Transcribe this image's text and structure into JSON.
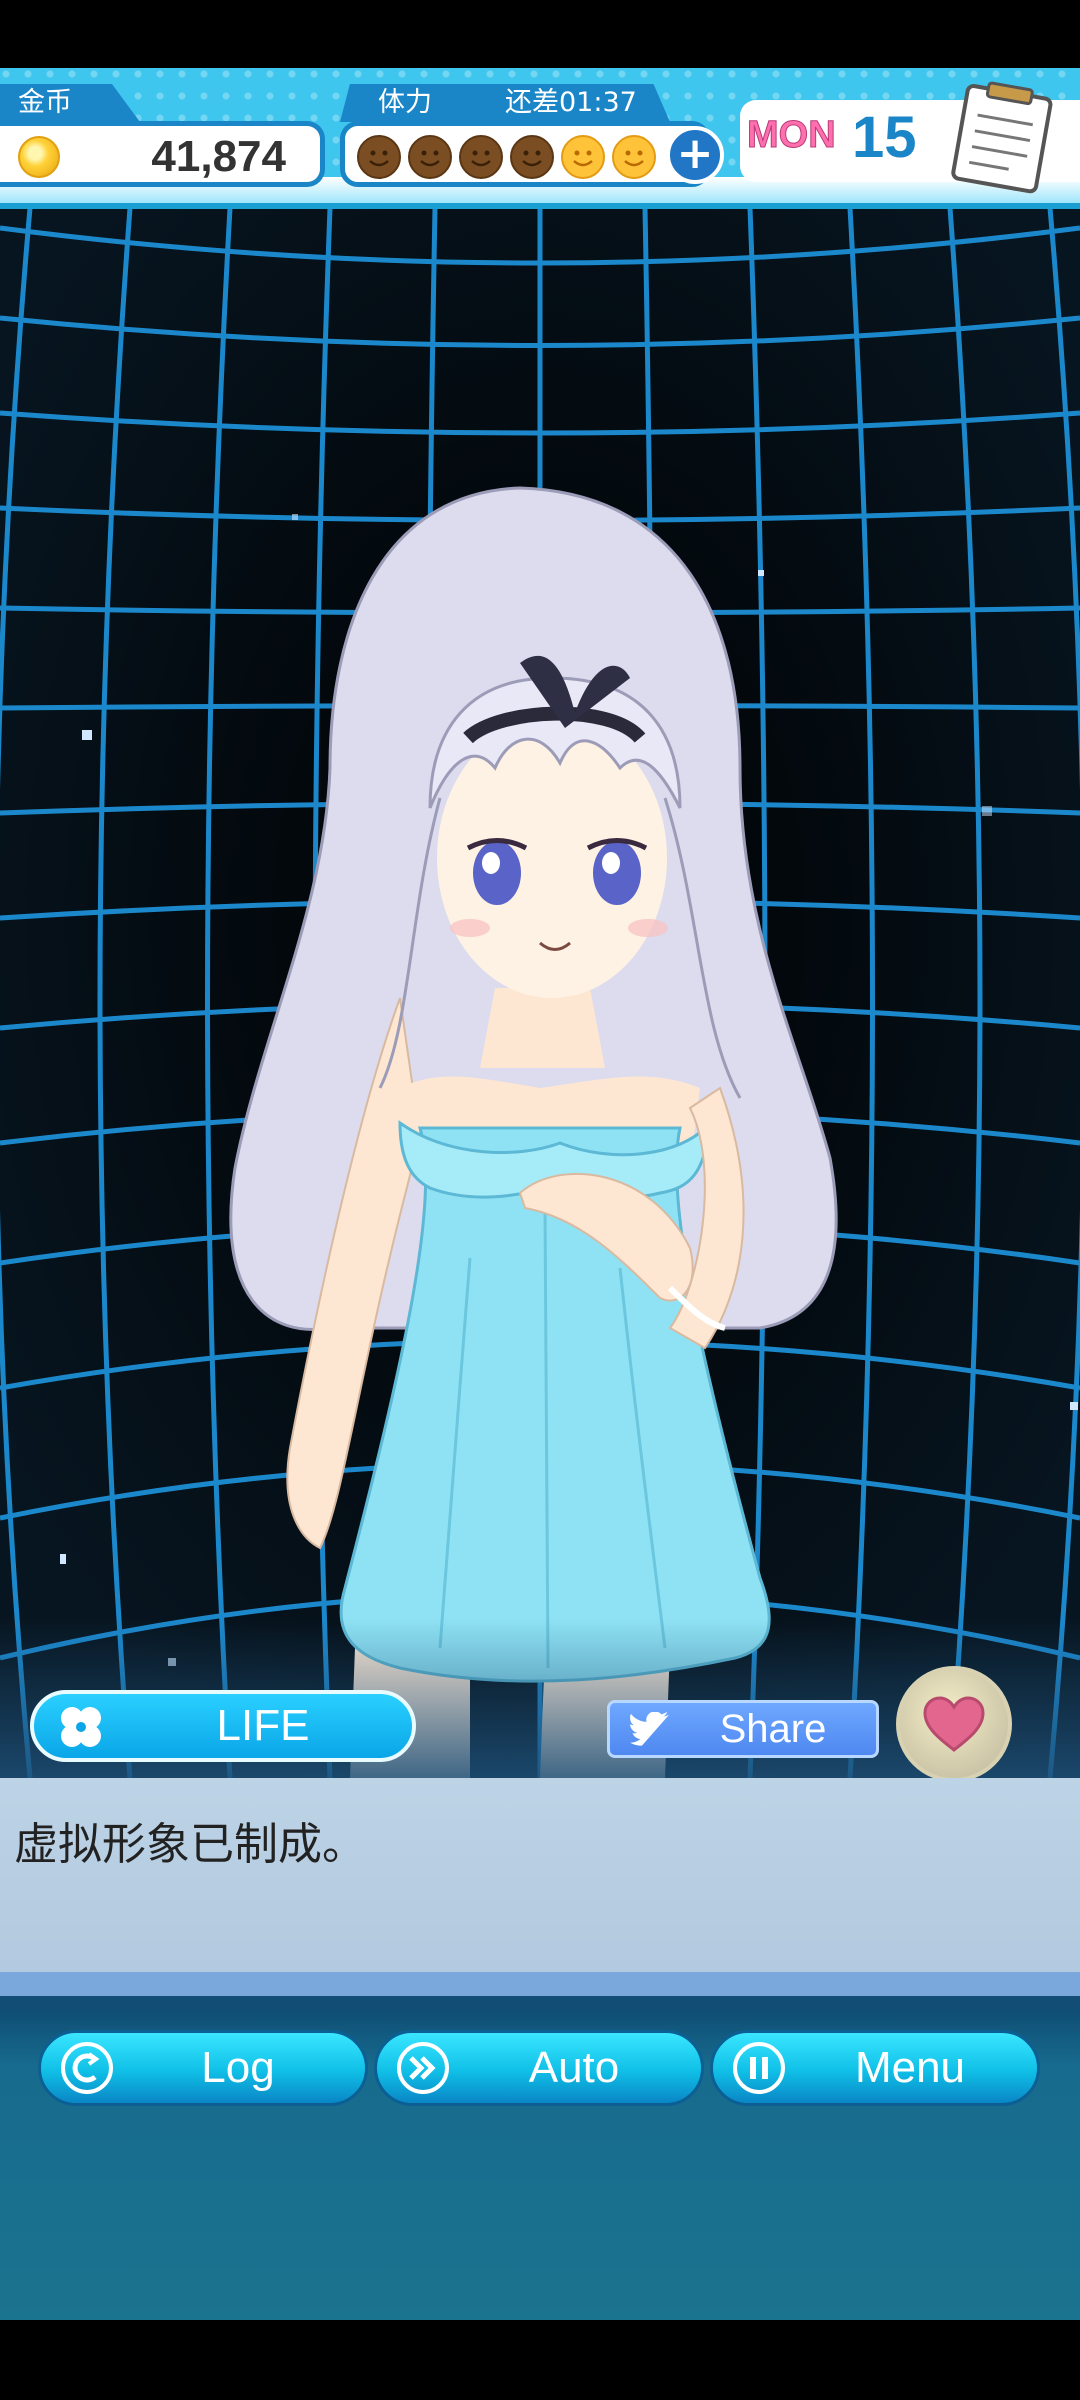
{
  "hud": {
    "coin_label": "金币",
    "coin_value": "41,874",
    "stamina_label": "体力",
    "stamina_timer": "还差01:37",
    "stamina_icons": [
      "brown",
      "brown",
      "brown",
      "brown",
      "gold",
      "gold"
    ],
    "plus_label": "+",
    "day_name": "MON",
    "day_number": "15",
    "notebook_icon": "notebook-icon"
  },
  "scene": {
    "character": "silver-haired girl in light blue dress",
    "background": "blue perspective grid"
  },
  "actions": {
    "life_label": "LIFE",
    "share_label": "Share",
    "heart_icon": "heart-icon"
  },
  "dialogue": {
    "text": "虚拟形象已制成。"
  },
  "controls": {
    "log_label": "Log",
    "auto_label": "Auto",
    "menu_label": "Menu"
  },
  "colors": {
    "hud_blue": "#3fc6ee",
    "button_cyan": "#0fbfe6",
    "grid_blue": "#1e8fd6",
    "dress_blue": "#8fe2f4",
    "heart_pink": "#e3668e"
  }
}
